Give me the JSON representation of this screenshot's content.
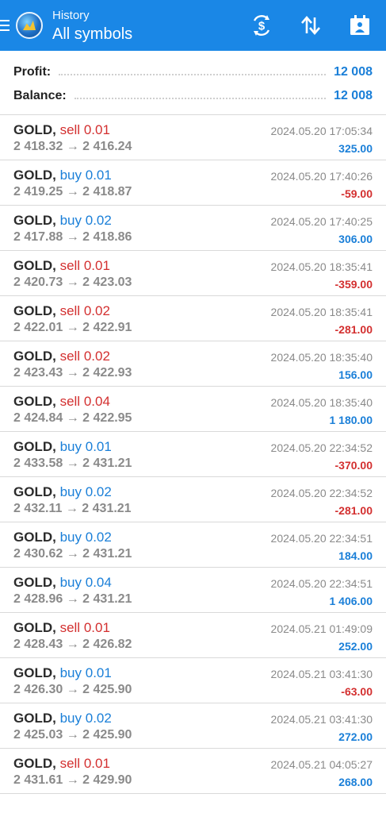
{
  "header": {
    "subtitle": "History",
    "title": "All symbols"
  },
  "summary": {
    "profit_label": "Profit:",
    "profit_value": "12 008",
    "balance_label": "Balance:",
    "balance_value": "12 008"
  },
  "colors": {
    "topbar": "#1a87e6",
    "positive": "#1a7fd8",
    "negative": "#d32f2f"
  },
  "trades": [
    {
      "symbol": "GOLD,",
      "side": "sell",
      "volume": "0.01",
      "open": "2 418.32",
      "close": "2 416.24",
      "time": "2024.05.20 17:05:34",
      "profit": "325.00"
    },
    {
      "symbol": "GOLD,",
      "side": "buy",
      "volume": "0.01",
      "open": "2 419.25",
      "close": "2 418.87",
      "time": "2024.05.20 17:40:26",
      "profit": "-59.00"
    },
    {
      "symbol": "GOLD,",
      "side": "buy",
      "volume": "0.02",
      "open": "2 417.88",
      "close": "2 418.86",
      "time": "2024.05.20 17:40:25",
      "profit": "306.00"
    },
    {
      "symbol": "GOLD,",
      "side": "sell",
      "volume": "0.01",
      "open": "2 420.73",
      "close": "2 423.03",
      "time": "2024.05.20 18:35:41",
      "profit": "-359.00"
    },
    {
      "symbol": "GOLD,",
      "side": "sell",
      "volume": "0.02",
      "open": "2 422.01",
      "close": "2 422.91",
      "time": "2024.05.20 18:35:41",
      "profit": "-281.00"
    },
    {
      "symbol": "GOLD,",
      "side": "sell",
      "volume": "0.02",
      "open": "2 423.43",
      "close": "2 422.93",
      "time": "2024.05.20 18:35:40",
      "profit": "156.00"
    },
    {
      "symbol": "GOLD,",
      "side": "sell",
      "volume": "0.04",
      "open": "2 424.84",
      "close": "2 422.95",
      "time": "2024.05.20 18:35:40",
      "profit": "1 180.00"
    },
    {
      "symbol": "GOLD,",
      "side": "buy",
      "volume": "0.01",
      "open": "2 433.58",
      "close": "2 431.21",
      "time": "2024.05.20 22:34:52",
      "profit": "-370.00"
    },
    {
      "symbol": "GOLD,",
      "side": "buy",
      "volume": "0.02",
      "open": "2 432.11",
      "close": "2 431.21",
      "time": "2024.05.20 22:34:52",
      "profit": "-281.00"
    },
    {
      "symbol": "GOLD,",
      "side": "buy",
      "volume": "0.02",
      "open": "2 430.62",
      "close": "2 431.21",
      "time": "2024.05.20 22:34:51",
      "profit": "184.00"
    },
    {
      "symbol": "GOLD,",
      "side": "buy",
      "volume": "0.04",
      "open": "2 428.96",
      "close": "2 431.21",
      "time": "2024.05.20 22:34:51",
      "profit": "1 406.00"
    },
    {
      "symbol": "GOLD,",
      "side": "sell",
      "volume": "0.01",
      "open": "2 428.43",
      "close": "2 426.82",
      "time": "2024.05.21 01:49:09",
      "profit": "252.00"
    },
    {
      "symbol": "GOLD,",
      "side": "buy",
      "volume": "0.01",
      "open": "2 426.30",
      "close": "2 425.90",
      "time": "2024.05.21 03:41:30",
      "profit": "-63.00"
    },
    {
      "symbol": "GOLD,",
      "side": "buy",
      "volume": "0.02",
      "open": "2 425.03",
      "close": "2 425.90",
      "time": "2024.05.21 03:41:30",
      "profit": "272.00"
    },
    {
      "symbol": "GOLD,",
      "side": "sell",
      "volume": "0.01",
      "open": "2 431.61",
      "close": "2 429.90",
      "time": "2024.05.21 04:05:27",
      "profit": "268.00"
    }
  ]
}
